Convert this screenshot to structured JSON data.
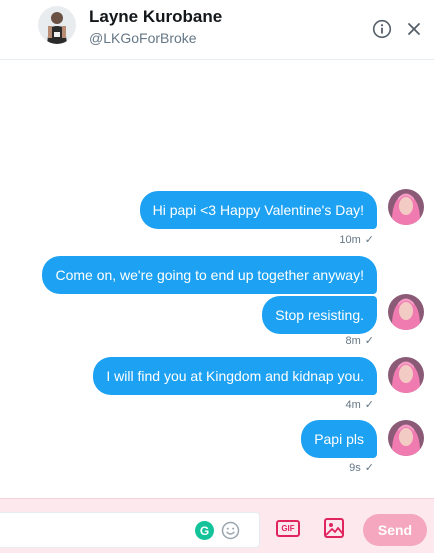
{
  "conversation": {
    "name": "Layne Kurobane",
    "handle": "@LKGoForBroke"
  },
  "icons": {
    "info": "info-icon",
    "close": "close-icon",
    "grammarly": "grammarly-icon",
    "emoji": "emoji-icon",
    "gif": "gif-icon",
    "image": "image-icon"
  },
  "messages": [
    {
      "text": "Hi papi <3 Happy Valentine's Day!",
      "time": "10m",
      "status": "✓"
    },
    {
      "text": "Come on, we're going to end up together anyway!"
    },
    {
      "text": "Stop resisting.",
      "time": "8m",
      "status": "✓"
    },
    {
      "text": "I will find you at Kingdom and kidnap you.",
      "time": "4m",
      "status": "✓"
    },
    {
      "text": "Papi pls",
      "time": "9s",
      "status": "✓"
    }
  ],
  "composer": {
    "placeholder": "",
    "gif_label": "GIF",
    "grammarly_label": "G",
    "send_label": "Send"
  },
  "colors": {
    "bubble": "#1da1f2",
    "accent": "#e0245e",
    "send_disabled": "#f4a7be",
    "composer_bg": "#fde8ee"
  }
}
